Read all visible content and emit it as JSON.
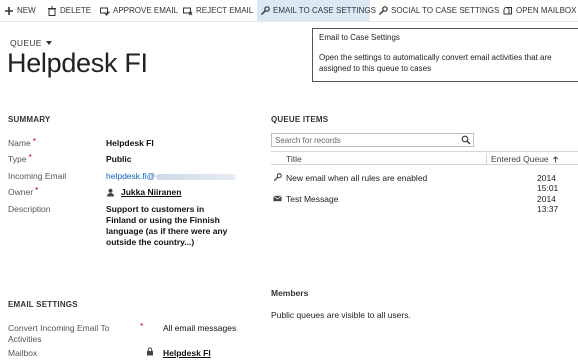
{
  "toolbar": {
    "new": "NEW",
    "delete": "DELETE",
    "approve_email": "APPROVE EMAIL",
    "reject_email": "REJECT EMAIL",
    "email_to_case": "EMAIL TO CASE SETTINGS",
    "social_to_case": "SOCIAL TO CASE SETTINGS",
    "open_mailbox": "OPEN MAILBOX"
  },
  "header": {
    "entity_label": "QUEUE",
    "title": "Helpdesk FI"
  },
  "tooltip": {
    "title": "Email to Case Settings",
    "body": "Open the settings to automatically convert email activities that are assigned to this queue to cases"
  },
  "summary": {
    "heading": "SUMMARY",
    "name_label": "Name",
    "name_value": "Helpdesk FI",
    "type_label": "Type",
    "type_value": "Public",
    "email_label": "Incoming Email",
    "email_value": "helpdesk.fi@",
    "owner_label": "Owner",
    "owner_value": "Jukka Niiranen",
    "description_label": "Description",
    "description_value": "Support to customers in Finland or using the Finnish language (as if there were any outside the country...)"
  },
  "email_settings": {
    "heading": "EMAIL SETTINGS",
    "convert_label": "Convert Incoming Email To Activities",
    "convert_value": "All email messages",
    "mailbox_label": "Mailbox",
    "mailbox_value": "Helpdesk FI"
  },
  "queue_items": {
    "heading": "QUEUE ITEMS",
    "search_placeholder": "Search for records",
    "col_title": "Title",
    "col_entered": "Entered Queue",
    "rows": [
      {
        "icon": "wrench-icon",
        "title": "New email when all rules are enabled",
        "date": "2014 15:01"
      },
      {
        "icon": "envelope-icon",
        "title": "Test Message",
        "date": "2014 13:37"
      }
    ]
  },
  "members": {
    "heading": "Members",
    "text": "Public queues are visible to all users."
  },
  "colors": {
    "active_button_bg": "#dbe9f7",
    "link": "#1060c0",
    "required": "#cc0000"
  }
}
